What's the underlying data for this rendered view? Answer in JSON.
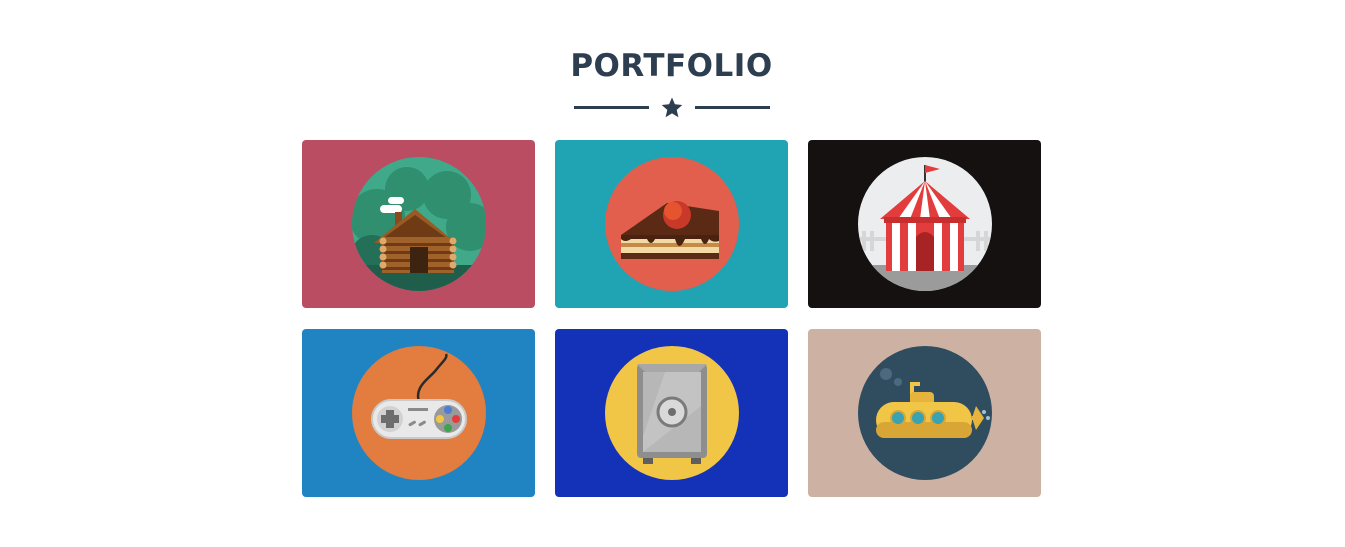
{
  "section": {
    "title": "PORTFOLIO",
    "divider_icon": "star-icon",
    "text_color": "#2c3e50"
  },
  "portfolio": {
    "items": [
      {
        "icon": "log-cabin-icon",
        "background": "#bb4d63",
        "circle": "#3fa98a"
      },
      {
        "icon": "cake-slice-icon",
        "background": "#20a3b3",
        "circle": "#e15f4c"
      },
      {
        "icon": "circus-tent-icon",
        "background": "#151111",
        "circle": "#ecedee"
      },
      {
        "icon": "game-controller-icon",
        "background": "#2184c2",
        "circle": "#e27c3f"
      },
      {
        "icon": "safe-icon",
        "background": "#1432b8",
        "circle": "#f1c545"
      },
      {
        "icon": "submarine-icon",
        "background": "#cdb2a4",
        "circle": "#304c5f"
      }
    ]
  }
}
